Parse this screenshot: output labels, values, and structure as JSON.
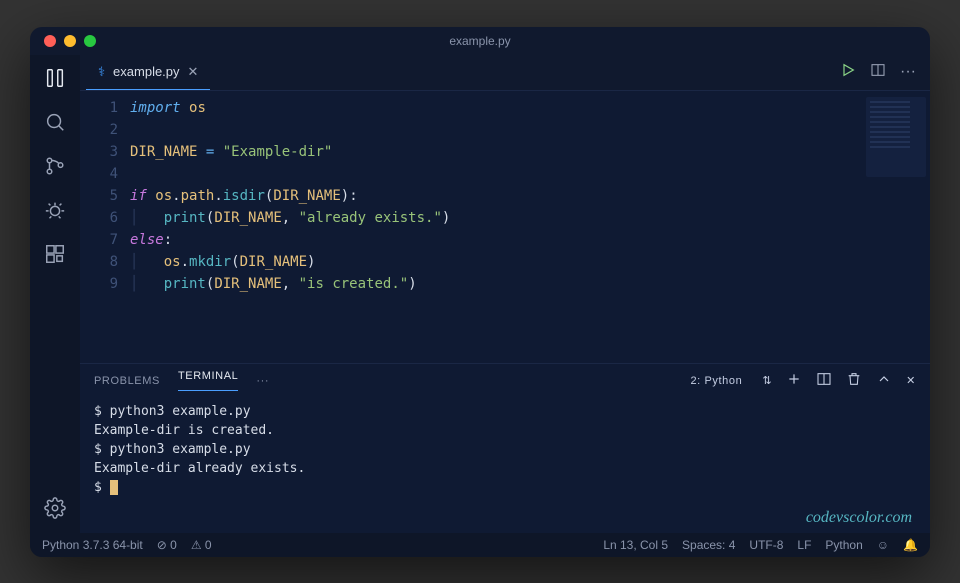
{
  "window": {
    "title": "example.py"
  },
  "tab": {
    "filename": "example.py"
  },
  "code": {
    "lines": [
      {
        "n": "1",
        "html": "<span class='imp'>import</span> <span class='var'>os</span>"
      },
      {
        "n": "2",
        "html": ""
      },
      {
        "n": "3",
        "html": "<span class='var'>DIR_NAME</span> <span class='op'>=</span> <span class='str'>\"Example-dir\"</span>"
      },
      {
        "n": "4",
        "html": ""
      },
      {
        "n": "5",
        "html": "<span class='kw'>if</span> <span class='var'>os</span><span class='pl'>.</span><span class='var'>path</span><span class='pl'>.</span><span class='fn'>isdir</span><span class='pl'>(</span><span class='var'>DIR_NAME</span><span class='pl'>):</span>"
      },
      {
        "n": "6",
        "html": "<span class='guide'>│   </span><span class='fn'>print</span><span class='pl'>(</span><span class='var'>DIR_NAME</span><span class='pl'>, </span><span class='str'>\"already exists.\"</span><span class='pl'>)</span>"
      },
      {
        "n": "7",
        "html": "<span class='kw'>else</span><span class='pl'>:</span>"
      },
      {
        "n": "8",
        "html": "<span class='guide'>│   </span><span class='var'>os</span><span class='pl'>.</span><span class='fn'>mkdir</span><span class='pl'>(</span><span class='var'>DIR_NAME</span><span class='pl'>)</span>"
      },
      {
        "n": "9",
        "html": "<span class='guide'>│   </span><span class='fn'>print</span><span class='pl'>(</span><span class='var'>DIR_NAME</span><span class='pl'>, </span><span class='str'>\"is created.\"</span><span class='pl'>)</span>"
      }
    ]
  },
  "panel": {
    "tabs": [
      "PROBLEMS",
      "TERMINAL"
    ],
    "active": "TERMINAL",
    "selector": "2: Python"
  },
  "terminal": {
    "lines": [
      "$ python3 example.py",
      "Example-dir is created.",
      "$ python3 example.py",
      "Example-dir already exists.",
      "$ "
    ]
  },
  "status": {
    "python": "Python 3.7.3 64-bit",
    "errors": "0",
    "warnings": "0",
    "pos": "Ln 13, Col 5",
    "spaces": "Spaces: 4",
    "enc": "UTF-8",
    "eol": "LF",
    "lang": "Python"
  },
  "watermark": "codevscolor.com"
}
